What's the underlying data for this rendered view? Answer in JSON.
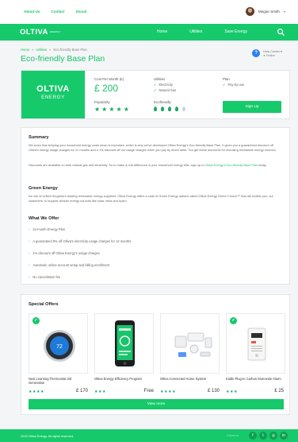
{
  "topbar": {
    "links": [
      "About Us",
      "Contact",
      "Social"
    ],
    "user_name": "Megan Smith"
  },
  "nav": {
    "logo": "OLTIVA",
    "logo_sub": "ENERGY",
    "items": [
      "Home",
      "Utilities",
      "Save Energy"
    ]
  },
  "breadcrumb": {
    "home": "Home",
    "utilities": "Utilities",
    "current": "Eco-friendly Base Plan",
    "sep": "»"
  },
  "page_title": "Eco-friendly Base Plan",
  "help": {
    "title": "Help Center",
    "status": "Online"
  },
  "plan": {
    "brand": "OLTIVA",
    "brand_sub": "ENERGY",
    "cost_label": "Cost Per Month (£)",
    "cost_value": "£ 200",
    "popularity_label": "Popularity",
    "popularity": 5,
    "utilities_label": "Utilities",
    "utilities": [
      "Electricity",
      "Natural Gas"
    ],
    "ecofriendly_label": "Ecofriendly",
    "ecofriendly": 4,
    "plan_label": "Plan",
    "plan_type": "Pay-by-use",
    "signup_label": "Sign Up"
  },
  "summary": {
    "title": "Summary",
    "p1": "We know that keeping your household energy costs down is important, which is why we've developed Oltiva Energy's Eco-friendly Base Plan. It gives you a guaranteed discount off Oltiva's energy usage charges for 12 months and a 1% discount off our usage charges when you pay by direct debit. You get these discounts for choosing renewable energy sources.",
    "p2_pre": "Discounts are available on both natural gas and electricity. So to make a real difference in your household energy bills, sign up to ",
    "p2_link": "Oltiva Energy's Eco-friendly Base Plan",
    "p2_post": " today."
  },
  "green": {
    "title": "Green Energy",
    "p": "As one of United Kingdom's leading renewable energy suppliers, Oltiva Energy offers a suite of Green Energy options called Oltiva Energy Green Choice™ that will enable you, our customers, to support cleaner energy sources like solar, wind and hydro."
  },
  "offer": {
    "title": "What We Offer",
    "items": [
      "24-month Energy Plan",
      "A guaranteed 9% off Oltiva's electricity usage charges for 12 months",
      "1% discount off Oltiva Energy's usage charges",
      "Automatic online account setup and billing enrollment",
      "No cancellation fee"
    ]
  },
  "special": {
    "title": "Special Offers",
    "products": [
      {
        "name": "Nest Learning Thermostat 3rd Generation",
        "stars": 4,
        "price": "£ 170",
        "thermostat_reading": "72"
      },
      {
        "name": "Oltiva Energy Efficiency Program",
        "stars": 3,
        "price": "Free"
      },
      {
        "name": "Oltiva Connected Home System",
        "stars": 4,
        "price": "£ 130"
      },
      {
        "name": "Kidde Plug-In Carbon Monoxide Alarm",
        "stars": 3,
        "price": "£ 25"
      }
    ],
    "view_more": "View more"
  },
  "footer": {
    "copyright": "2015 Oltiva Energy. All rights reserved.",
    "follow": "Follow us"
  },
  "colors": {
    "brand_green": "#16c96b",
    "help_blue": "#2a7ff5"
  }
}
